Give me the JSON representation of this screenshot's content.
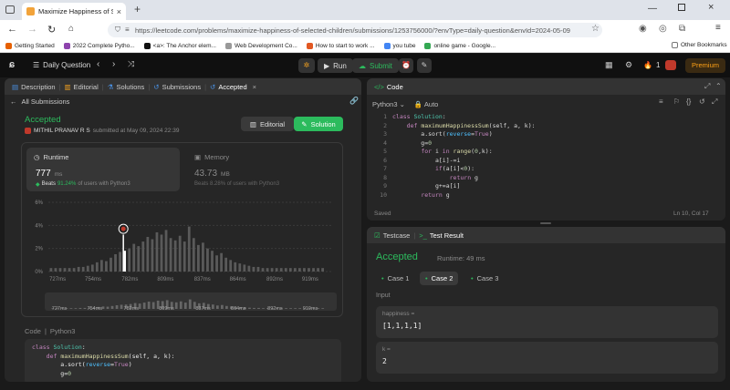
{
  "browser": {
    "tab_title": "Maximize Happiness of Selecte",
    "url": "https://leetcode.com/problems/maximize-happiness-of-selected-children/submissions/1253756000/?envType=daily-question&envId=2024-05-09",
    "bookmarks": [
      "Getting Started",
      "2022 Complete Pytho...",
      "<a>: The Anchor elem...",
      "Web Development Co...",
      "How to start to work ...",
      "you tube",
      "online game - Google..."
    ],
    "other_bookmarks": "Other Bookmarks"
  },
  "header": {
    "daily_question": "Daily Question",
    "run": "Run",
    "submit": "Submit",
    "streak": "1",
    "premium": "Premium"
  },
  "left": {
    "tabs": [
      "Description",
      "Editorial",
      "Solutions",
      "Submissions",
      "Accepted"
    ],
    "all_submissions": "All Submissions",
    "status": "Accepted",
    "user": "MITHIL PRANAV R S",
    "submitted_at": "submitted at May 09, 2024 22:39",
    "editorial_btn": "Editorial",
    "solution_btn": "Solution",
    "runtime_label": "Runtime",
    "runtime_value": "777",
    "runtime_unit": "ms",
    "runtime_beats_prefix": "Beats",
    "runtime_beats_pct": "91.24%",
    "runtime_beats_suffix": "of users with Python3",
    "memory_label": "Memory",
    "memory_value": "43.73",
    "memory_unit": "MB",
    "memory_beats": "Beats 8.28% of users with Python3",
    "code_label": "Code",
    "lang": "Python3",
    "code_lines": [
      "class Solution:",
      "    def maximumHappinessSum(self, a, k):",
      "        a.sort(reverse=True)",
      "        g=0"
    ]
  },
  "chart_data": {
    "type": "bar",
    "ylabel": "",
    "yticks": [
      "6%",
      "4%",
      "2%",
      "0%"
    ],
    "ylim": [
      0,
      6
    ],
    "xticks": [
      "727ms",
      "754ms",
      "782ms",
      "809ms",
      "837ms",
      "864ms",
      "892ms",
      "919ms"
    ],
    "xlim": [
      720,
      935
    ],
    "highlight_x": 777,
    "highlight_value": 2.0,
    "bin_start": 722,
    "bin_width": 3.5,
    "values": [
      0.3,
      0.3,
      0.3,
      0.3,
      0.3,
      0.3,
      0.4,
      0.4,
      0.5,
      0.6,
      0.8,
      1.0,
      0.9,
      1.2,
      1.5,
      1.7,
      1.8,
      2.0,
      2.4,
      2.2,
      2.6,
      3.0,
      2.8,
      3.4,
      3.2,
      3.6,
      2.9,
      2.7,
      3.1,
      2.6,
      3.9,
      2.9,
      2.3,
      2.5,
      2.0,
      1.8,
      1.4,
      1.6,
      1.2,
      1.0,
      0.8,
      0.7,
      0.6,
      0.5,
      0.4,
      0.4,
      0.3,
      0.3,
      0.3,
      0.3,
      0.3,
      0.3,
      0.3,
      0.3,
      0.3,
      0.3,
      0.3,
      0.3,
      0.3,
      0.3
    ]
  },
  "right": {
    "code_tab": "Code",
    "lang": "Python3",
    "auto": "Auto",
    "code_lines": [
      "class Solution:",
      "    def maximumHappinessSum(self, a, k):",
      "        a.sort(reverse=True)",
      "        g=0",
      "        for i in range(0,k):",
      "            a[i]-=i",
      "            if(a[i]<0):",
      "                return g",
      "            g+=a[i]",
      "        return g"
    ],
    "saved": "Saved",
    "cursor_pos": "Ln 10, Col 17",
    "testcase_tab": "Testcase",
    "testresult_tab": "Test Result",
    "result_status": "Accepted",
    "result_runtime": "Runtime: 49 ms",
    "cases": [
      "Case 1",
      "Case 2",
      "Case 3"
    ],
    "input_label": "Input",
    "vars": [
      {
        "name": "happiness =",
        "value": "[1,1,1,1]"
      },
      {
        "name": "k =",
        "value": "2"
      }
    ]
  },
  "colors": {
    "accent": "#2cbb5d",
    "premium": "#ffa116",
    "bg": "#1a1a1a",
    "panel": "#262626"
  }
}
